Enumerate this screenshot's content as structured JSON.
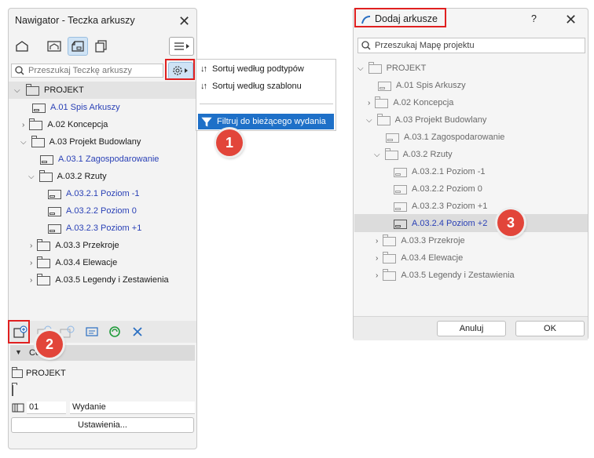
{
  "navigator": {
    "title": "Nawigator - Teczka arkuszy",
    "close": "✕",
    "search_placeholder": "Przeszukaj Teczkę arkuszy",
    "tree": {
      "root": "PROJEKT",
      "items": [
        {
          "label": "A.01 Spis Arkuszy"
        },
        {
          "label": "A.02 Koncepcja"
        },
        {
          "label": "A.03 Projekt Budowlany"
        },
        {
          "label": "A.03.1 Zagospodarowanie"
        },
        {
          "label": "A.03.2 Rzuty"
        },
        {
          "label": "A.03.2.1 Poziom -1"
        },
        {
          "label": "A.03.2.2 Poziom 0"
        },
        {
          "label": "A.03.2.3 Poziom +1"
        },
        {
          "label": "A.03.3 Przekroje"
        },
        {
          "label": "A.03.4 Elewacje"
        },
        {
          "label": "A.03.5 Legendy i Zestawienia"
        }
      ]
    },
    "section_title": "Ce",
    "info_project": "PROJEKT",
    "issue_number": "01",
    "issue_name": "Wydanie",
    "settings_button": "Ustawienia..."
  },
  "context_menu": {
    "items": [
      {
        "label": "Sortuj według podtypów"
      },
      {
        "label": "Sortuj według szablonu"
      },
      {
        "label": "Filtruj do bieżącego wydania"
      }
    ],
    "sort_glyph": "↓↑"
  },
  "dialog": {
    "title": "Dodaj arkusze",
    "help": "?",
    "close": "✕",
    "search_placeholder": "Przeszukaj Mapę projektu",
    "tree": {
      "root": "PROJEKT",
      "items": [
        {
          "label": "A.01 Spis Arkuszy"
        },
        {
          "label": "A.02 Koncepcja"
        },
        {
          "label": "A.03 Projekt Budowlany"
        },
        {
          "label": "A.03.1 Zagospodarowanie"
        },
        {
          "label": "A.03.2 Rzuty"
        },
        {
          "label": "A.03.2.1 Poziom -1"
        },
        {
          "label": "A.03.2.2 Poziom 0"
        },
        {
          "label": "A.03.2.3 Poziom +1"
        },
        {
          "label": "A.03.2.4 Poziom +2"
        },
        {
          "label": "A.03.3 Przekroje"
        },
        {
          "label": "A.03.4 Elewacje"
        },
        {
          "label": "A.03.5 Legendy i Zestawienia"
        }
      ]
    },
    "cancel_button": "Anuluj",
    "ok_button": "OK"
  },
  "badges": [
    "1",
    "2",
    "3"
  ],
  "colors": {
    "accent_red": "#e02020",
    "badge_red": "#e2453a",
    "link_blue": "#2a41b6",
    "highlight_blue": "#1e70c8",
    "selection_blue": "#cfe3f5"
  }
}
